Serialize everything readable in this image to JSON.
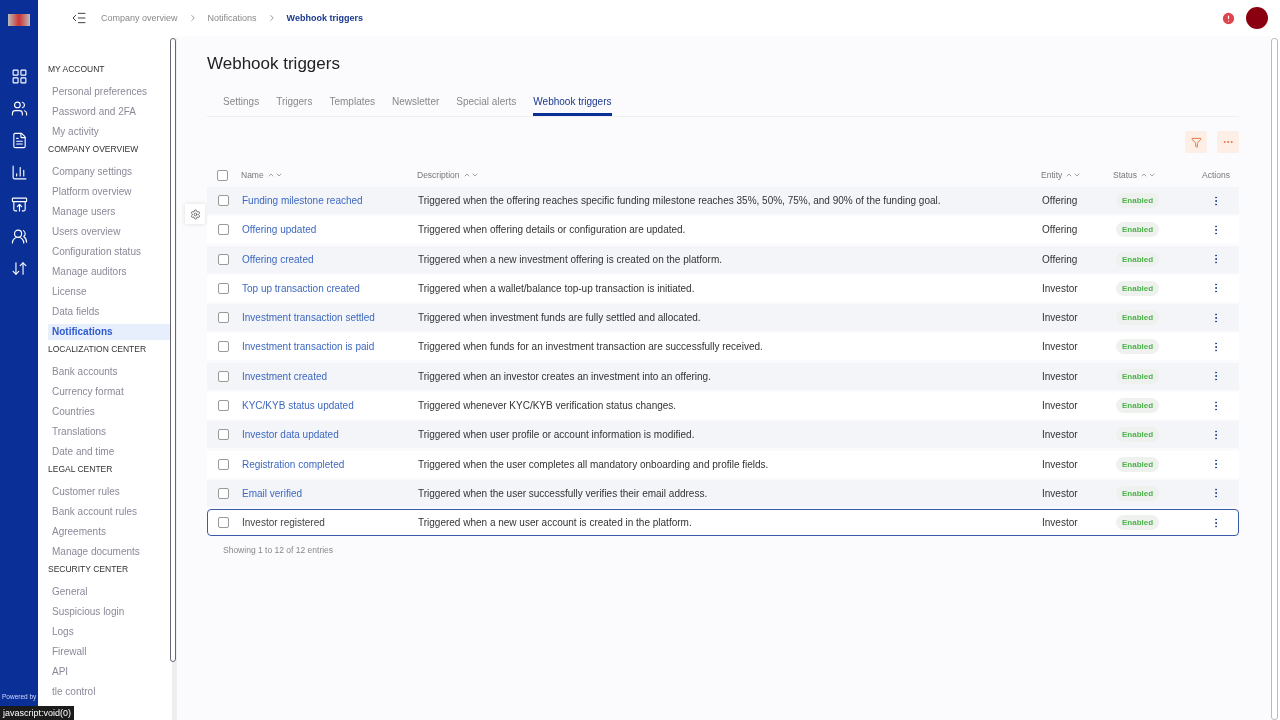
{
  "breadcrumb": [
    {
      "label": "Company overview",
      "current": false
    },
    {
      "label": "Notifications",
      "current": false
    },
    {
      "label": "Webhook triggers",
      "current": true
    }
  ],
  "sidebar": {
    "sections": [
      {
        "title": "MY ACCOUNT",
        "items": [
          {
            "label": "Personal preferences",
            "selected": false
          },
          {
            "label": "Password and 2FA",
            "selected": false
          },
          {
            "label": "My activity",
            "selected": false
          }
        ]
      },
      {
        "title": "COMPANY OVERVIEW",
        "items": [
          {
            "label": "Company settings",
            "selected": false
          },
          {
            "label": "Platform overview",
            "selected": false
          },
          {
            "label": "Manage users",
            "selected": false
          },
          {
            "label": "Users overview",
            "selected": false
          },
          {
            "label": "Configuration status",
            "selected": false
          },
          {
            "label": "Manage auditors",
            "selected": false
          },
          {
            "label": "License",
            "selected": false
          },
          {
            "label": "Data fields",
            "selected": false
          },
          {
            "label": "Notifications",
            "selected": true
          }
        ]
      },
      {
        "title": "LOCALIZATION CENTER",
        "items": [
          {
            "label": "Bank accounts",
            "selected": false
          },
          {
            "label": "Currency format",
            "selected": false
          },
          {
            "label": "Countries",
            "selected": false
          },
          {
            "label": "Translations",
            "selected": false
          },
          {
            "label": "Date and time",
            "selected": false
          }
        ]
      },
      {
        "title": "LEGAL CENTER",
        "items": [
          {
            "label": "Customer rules",
            "selected": false
          },
          {
            "label": "Bank account rules",
            "selected": false
          },
          {
            "label": "Agreements",
            "selected": false
          },
          {
            "label": "Manage documents",
            "selected": false
          }
        ]
      },
      {
        "title": "SECURITY CENTER",
        "items": [
          {
            "label": "General",
            "selected": false
          },
          {
            "label": "Suspicious login",
            "selected": false
          },
          {
            "label": "Logs",
            "selected": false
          },
          {
            "label": "Firewall",
            "selected": false
          },
          {
            "label": "API",
            "selected": false
          },
          {
            "label": "tle control",
            "selected": false
          }
        ]
      }
    ]
  },
  "powered_by": "Powered by",
  "status_tooltip": "javascript:void(0)",
  "page_title": "Webhook triggers",
  "tabs": [
    {
      "label": "Settings",
      "selected": false
    },
    {
      "label": "Triggers",
      "selected": false
    },
    {
      "label": "Templates",
      "selected": false
    },
    {
      "label": "Newsletter",
      "selected": false
    },
    {
      "label": "Special alerts",
      "selected": false
    },
    {
      "label": "Webhook triggers",
      "selected": true
    }
  ],
  "table": {
    "columns": [
      "Name",
      "Description",
      "Entity",
      "Status",
      "Actions"
    ],
    "select_all_checked": false,
    "rows": [
      {
        "name": "Funding milestone reached",
        "description": "Triggered when the offering reaches specific funding milestone reaches 35%, 50%, 75%, and 90% of the funding goal.",
        "entity": "Offering",
        "status": "Enabled",
        "checked": false,
        "hovered": false
      },
      {
        "name": "Offering updated",
        "description": "Triggered when offering details or configuration are updated.",
        "entity": "Offering",
        "status": "Enabled",
        "checked": false,
        "hovered": false
      },
      {
        "name": "Offering created",
        "description": "Triggered when a new investment offering is created on the platform.",
        "entity": "Offering",
        "status": "Enabled",
        "checked": false,
        "hovered": false
      },
      {
        "name": "Top up transaction created",
        "description": "Triggered when a wallet/balance top-up transaction is initiated.",
        "entity": "Investor",
        "status": "Enabled",
        "checked": false,
        "hovered": false
      },
      {
        "name": "Investment transaction settled",
        "description": "Triggered when investment funds are fully settled and allocated.",
        "entity": "Investor",
        "status": "Enabled",
        "checked": false,
        "hovered": false
      },
      {
        "name": "Investment transaction is paid",
        "description": "Triggered when funds for an investment transaction are successfully received.",
        "entity": "Investor",
        "status": "Enabled",
        "checked": false,
        "hovered": false
      },
      {
        "name": "Investment created",
        "description": "Triggered when an investor creates an investment into an offering.",
        "entity": "Investor",
        "status": "Enabled",
        "checked": false,
        "hovered": false
      },
      {
        "name": "KYC/KYB status updated",
        "description": "Triggered whenever KYC/KYB verification status changes.",
        "entity": "Investor",
        "status": "Enabled",
        "checked": false,
        "hovered": false
      },
      {
        "name": "Investor data updated",
        "description": "Triggered when user profile or account information is modified.",
        "entity": "Investor",
        "status": "Enabled",
        "checked": false,
        "hovered": false
      },
      {
        "name": "Registration completed",
        "description": "Triggered when the user completes all mandatory onboarding and profile fields.",
        "entity": "Investor",
        "status": "Enabled",
        "checked": false,
        "hovered": false
      },
      {
        "name": "Email verified",
        "description": "Triggered when the user successfully verifies their email address.",
        "entity": "Investor",
        "status": "Enabled",
        "checked": false,
        "hovered": false
      },
      {
        "name": "Investor registered",
        "description": "Triggered when a new user account is created in the platform.",
        "entity": "Investor",
        "status": "Enabled",
        "checked": false,
        "hovered": true
      }
    ],
    "footer": "Showing 1 to 12 of 12 entries"
  }
}
